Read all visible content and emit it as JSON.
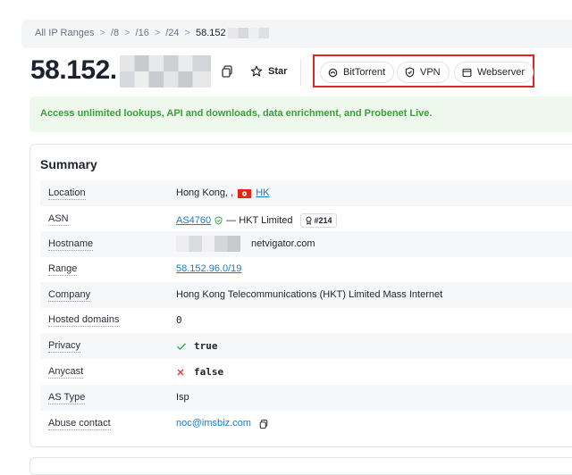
{
  "breadcrumb": {
    "items": [
      "All IP Ranges",
      "/8",
      "/16",
      "/24"
    ],
    "current": "58.152",
    "separator": ">"
  },
  "header": {
    "ip_prefix": "58.152.",
    "star_label": "Star"
  },
  "tags": [
    {
      "label": "BitTorrent",
      "icon": "bittorrent-icon"
    },
    {
      "label": "VPN",
      "icon": "shield-icon"
    },
    {
      "label": "Webserver",
      "icon": "browser-window-icon"
    }
  ],
  "banner": {
    "text": "Access unlimited lookups, API and downloads, data enrichment, and Probenet Live."
  },
  "summary": {
    "title": "Summary",
    "rows": {
      "location": {
        "label": "Location",
        "value": "Hong Kong, , ",
        "country_code": "HK"
      },
      "asn": {
        "label": "ASN",
        "asn": "AS4760",
        "org": "— HKT Limited",
        "rank": "#214"
      },
      "hostname": {
        "label": "Hostname",
        "value": "netvigator.com"
      },
      "range": {
        "label": "Range",
        "value": "58.152.96.0/19"
      },
      "company": {
        "label": "Company",
        "value": "Hong Kong Telecommunications (HKT) Limited Mass Internet"
      },
      "hosted_domains": {
        "label": "Hosted domains",
        "value": "0"
      },
      "privacy": {
        "label": "Privacy",
        "value": "true"
      },
      "anycast": {
        "label": "Anycast",
        "value": "false"
      },
      "as_type": {
        "label": "AS Type",
        "value": "Isp"
      },
      "abuse_contact": {
        "label": "Abuse contact",
        "value": "noc@imsbiz.com"
      }
    }
  },
  "colors": {
    "highlight_border": "#e02424",
    "banner_bg": "#eef8ec",
    "banner_text": "#3a9f3a",
    "link": "#1a7bc9",
    "check": "#2fa84f",
    "cross": "#d93636"
  }
}
